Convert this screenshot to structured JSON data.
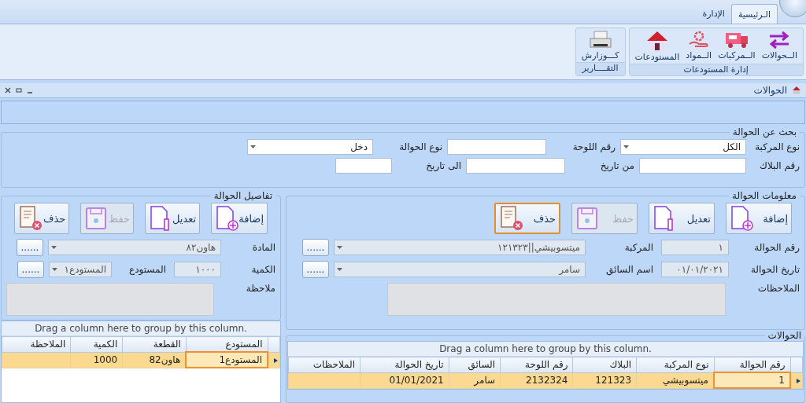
{
  "tabs": [
    {
      "label": "الـرئيسية",
      "selected": true
    },
    {
      "label": "الإدارة",
      "selected": false
    }
  ],
  "ribbon_groups": [
    {
      "label": "إدارة المستودعات",
      "buttons": [
        {
          "label": "الــحوالات",
          "kind": "arrows"
        },
        {
          "label": "الــمركبات",
          "kind": "truck"
        },
        {
          "label": "الــمواد",
          "kind": "hand"
        },
        {
          "label": "المستودعات",
          "kind": "house"
        }
      ]
    },
    {
      "label": "التقــــارير",
      "buttons": [
        {
          "label": "كـــوزارش",
          "kind": "printer"
        }
      ]
    }
  ],
  "document": {
    "title": "الحوالات"
  },
  "search": {
    "title": "بحث عن الحوالة",
    "rows": [
      [
        {
          "label": "نوع المركبة",
          "kind": "combo",
          "value": "الكل"
        },
        {
          "label": "رقم اللوحة",
          "kind": "text"
        },
        {
          "label": "نوع الحوالة",
          "kind": "combo",
          "value": "دخل"
        }
      ],
      [
        {
          "label": "رقم البلاك",
          "kind": "text"
        },
        {
          "label": "من تاريخ",
          "kind": "text"
        },
        {
          "label": "الى تاريخ",
          "kind": "text"
        }
      ]
    ]
  },
  "info": {
    "title": "معلومات الحوالة",
    "buttons": [
      {
        "label": "إضافة",
        "kind": "add",
        "disabled": false,
        "focused": false
      },
      {
        "label": "تعديل",
        "kind": "edit",
        "disabled": false,
        "focused": false
      },
      {
        "label": "حفظ",
        "kind": "save",
        "disabled": true,
        "focused": false
      },
      {
        "label": "حذف",
        "kind": "delete",
        "disabled": false,
        "focused": true
      }
    ],
    "rows": [
      [
        {
          "label": "رقم الحوالة",
          "kind": "text",
          "value": "١"
        },
        {
          "label": "المركبة",
          "kind": "combo",
          "value": "ميتسوبيشي||١٢١٣٢٣",
          "button": "......"
        }
      ],
      [
        {
          "label": "تاريخ الحوالة",
          "kind": "text",
          "value": "٠١/٠١/٢٠٢١"
        },
        {
          "label": "اسم السائق",
          "kind": "combo",
          "value": "سامر",
          "button": "......"
        }
      ]
    ],
    "memo": {
      "label": "الملاحظات"
    }
  },
  "details": {
    "title": "تفاصيل الحوالة",
    "buttons": [
      {
        "label": "إضافة",
        "kind": "add",
        "disabled": false,
        "focused": false
      },
      {
        "label": "تعديل",
        "kind": "edit",
        "disabled": false,
        "focused": false
      },
      {
        "label": "حفظ",
        "kind": "save",
        "disabled": true,
        "focused": false
      },
      {
        "label": "حذف",
        "kind": "delete",
        "disabled": false,
        "focused": false
      }
    ],
    "rows": [
      [
        {
          "label": "المادة",
          "kind": "combo",
          "value": "هاون٨٢",
          "button": "......"
        }
      ],
      [
        {
          "label": "الكمية",
          "kind": "text",
          "value": "١٠٠٠"
        },
        {
          "label": "المستودع",
          "kind": "combo",
          "value": "المستودع١",
          "button": "......"
        }
      ]
    ],
    "memo": {
      "label": "ملاحظة"
    }
  },
  "details_grid": {
    "group_hint": "Drag a column here to group by this column.",
    "columns": [
      "المستودع",
      "القطعة",
      "الكمية",
      "الملاحظة"
    ],
    "rows": [
      {
        "selected": true,
        "cells": [
          "المستودع1",
          "هاون82",
          "1000"
        ]
      }
    ]
  },
  "transfers": {
    "title": "الحوالات",
    "group_hint": "Drag a column here to group by this column.",
    "columns": [
      "رقم الحوالة",
      "نوع المركبة",
      "البلاك",
      "رقم اللوحة",
      "السائق",
      "تاريخ الحوالة",
      "الملاحظات"
    ],
    "rows": [
      {
        "selected": true,
        "cells": [
          "1",
          "ميتسوبيشي",
          "121323",
          "2132324",
          "سامر",
          "01/01/2021"
        ]
      }
    ]
  }
}
